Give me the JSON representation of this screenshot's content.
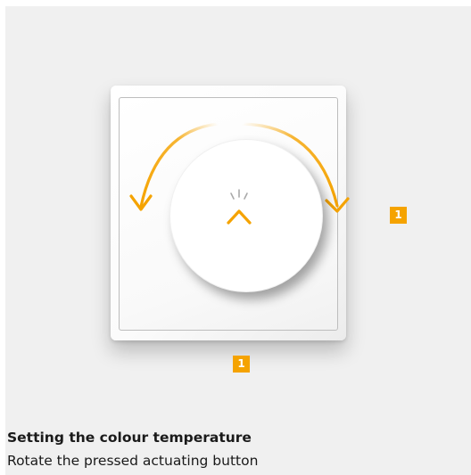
{
  "illustration": {
    "accent_color": "#f5a300",
    "badge_right": "1",
    "badge_bottom": "1",
    "icons": [
      "rotate-left-arrow-icon",
      "rotate-right-arrow-icon",
      "press-up-arrow-icon",
      "press-burst-icon"
    ]
  },
  "caption": {
    "title": "Setting the colour temperature",
    "subtitle": "Rotate the pressed actuating button"
  }
}
